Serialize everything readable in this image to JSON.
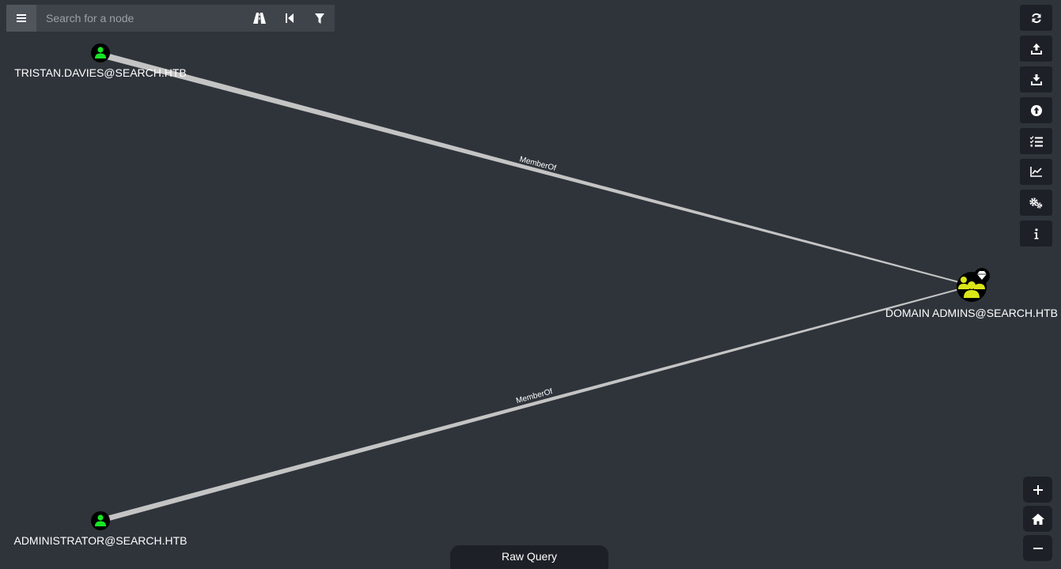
{
  "search": {
    "placeholder": "Search for a node"
  },
  "toolbar": {
    "search_buttons": [
      {
        "icon": "menu-icon"
      },
      {
        "icon": "pathfinding-road-icon"
      },
      {
        "icon": "back-step-icon"
      },
      {
        "icon": "filter-icon"
      }
    ],
    "right_buttons": [
      {
        "icon": "refresh-icon"
      },
      {
        "icon": "upload-icon"
      },
      {
        "icon": "download-icon"
      },
      {
        "icon": "import-circle-icon"
      },
      {
        "icon": "checklist-icon"
      },
      {
        "icon": "chart-line-icon"
      },
      {
        "icon": "settings-gears-icon"
      },
      {
        "icon": "info-icon"
      }
    ],
    "zoom_buttons": [
      {
        "icon": "zoom-in-icon"
      },
      {
        "icon": "home-icon"
      },
      {
        "icon": "zoom-out-icon"
      }
    ]
  },
  "graph": {
    "nodes": [
      {
        "id": "tristan",
        "label": "TRISTAN.DAVIES@SEARCH.HTB",
        "type": "User",
        "color": "#17e625"
      },
      {
        "id": "domainadmins",
        "label": "DOMAIN ADMINS@SEARCH.HTB",
        "type": "Group",
        "color": "#dbe617",
        "highvalue": true
      },
      {
        "id": "administrator",
        "label": "ADMINISTRATOR@SEARCH.HTB",
        "type": "User",
        "color": "#17e625"
      }
    ],
    "edges": [
      {
        "from": "tristan",
        "to": "domainadmins",
        "label": "MemberOf"
      },
      {
        "from": "administrator",
        "to": "domainadmins",
        "label": "MemberOf"
      }
    ]
  },
  "raw_query": {
    "label": "Raw Query"
  },
  "colors": {
    "background": "#2f343b",
    "edge": "#c8c8c8",
    "user": "#17e625",
    "group": "#dbe617"
  }
}
